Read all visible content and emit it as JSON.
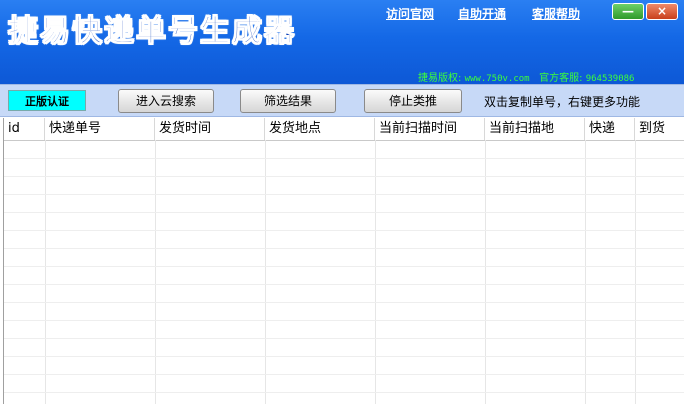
{
  "app": {
    "title": "捷易快递单号生成器"
  },
  "top_links": {
    "visit_site": "访问官网",
    "self_activate": "自助开通",
    "support": "客服帮助"
  },
  "window_controls": {
    "minimize": "—",
    "close": "×"
  },
  "copyright": {
    "label": "捷易版权:",
    "site": "www.750v.com",
    "service_label": "官方客服:",
    "service_qq": "964539086"
  },
  "toolbar": {
    "auth_badge": "正版认证",
    "cloud_search": "进入云搜索",
    "filter_results": "筛选结果",
    "stop_push": "停止类推",
    "hint": "双击复制单号，右键更多功能"
  },
  "table": {
    "columns": [
      "id",
      "快递单号",
      "发货时间",
      "发货地点",
      "当前扫描时间",
      "当前扫描地",
      "快递",
      "到货"
    ],
    "rows": []
  },
  "colors": {
    "titlebar": "#1468e6",
    "toolbar": "#c7d9f7",
    "auth_badge": "#00ffff",
    "copyright_text": "#3bff3b"
  }
}
